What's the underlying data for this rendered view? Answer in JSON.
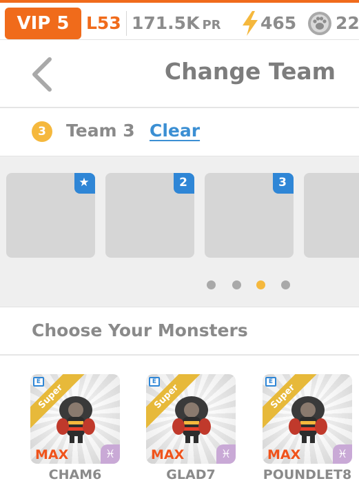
{
  "status": {
    "vip": "VIP 5",
    "level": "L53",
    "power": "171.5K",
    "power_unit": "PR",
    "energy": "465",
    "food": "22"
  },
  "header": {
    "title": "Change Team"
  },
  "team": {
    "number": "3",
    "name": "Team 3",
    "clear_label": "Clear"
  },
  "slots": [
    {
      "label": "★"
    },
    {
      "label": "2"
    },
    {
      "label": "3"
    },
    {
      "label": ""
    }
  ],
  "pager": {
    "pages": 4,
    "active": 3
  },
  "choose": {
    "title": "Choose Your Monsters"
  },
  "monsters": [
    {
      "name": "CHAM6",
      "rarity": "Super",
      "level_tag": "MAX",
      "element": "♓"
    },
    {
      "name": "GLAD7",
      "rarity": "Super",
      "level_tag": "MAX",
      "element": "♓"
    },
    {
      "name": "POUNDLET8",
      "rarity": "Super",
      "level_tag": "MAX",
      "element": "♓"
    }
  ],
  "colors": {
    "accent": "#f06b1b",
    "link": "#3b8fd3",
    "team_badge": "#f5b83d",
    "slot_corner": "#2f86d6"
  }
}
